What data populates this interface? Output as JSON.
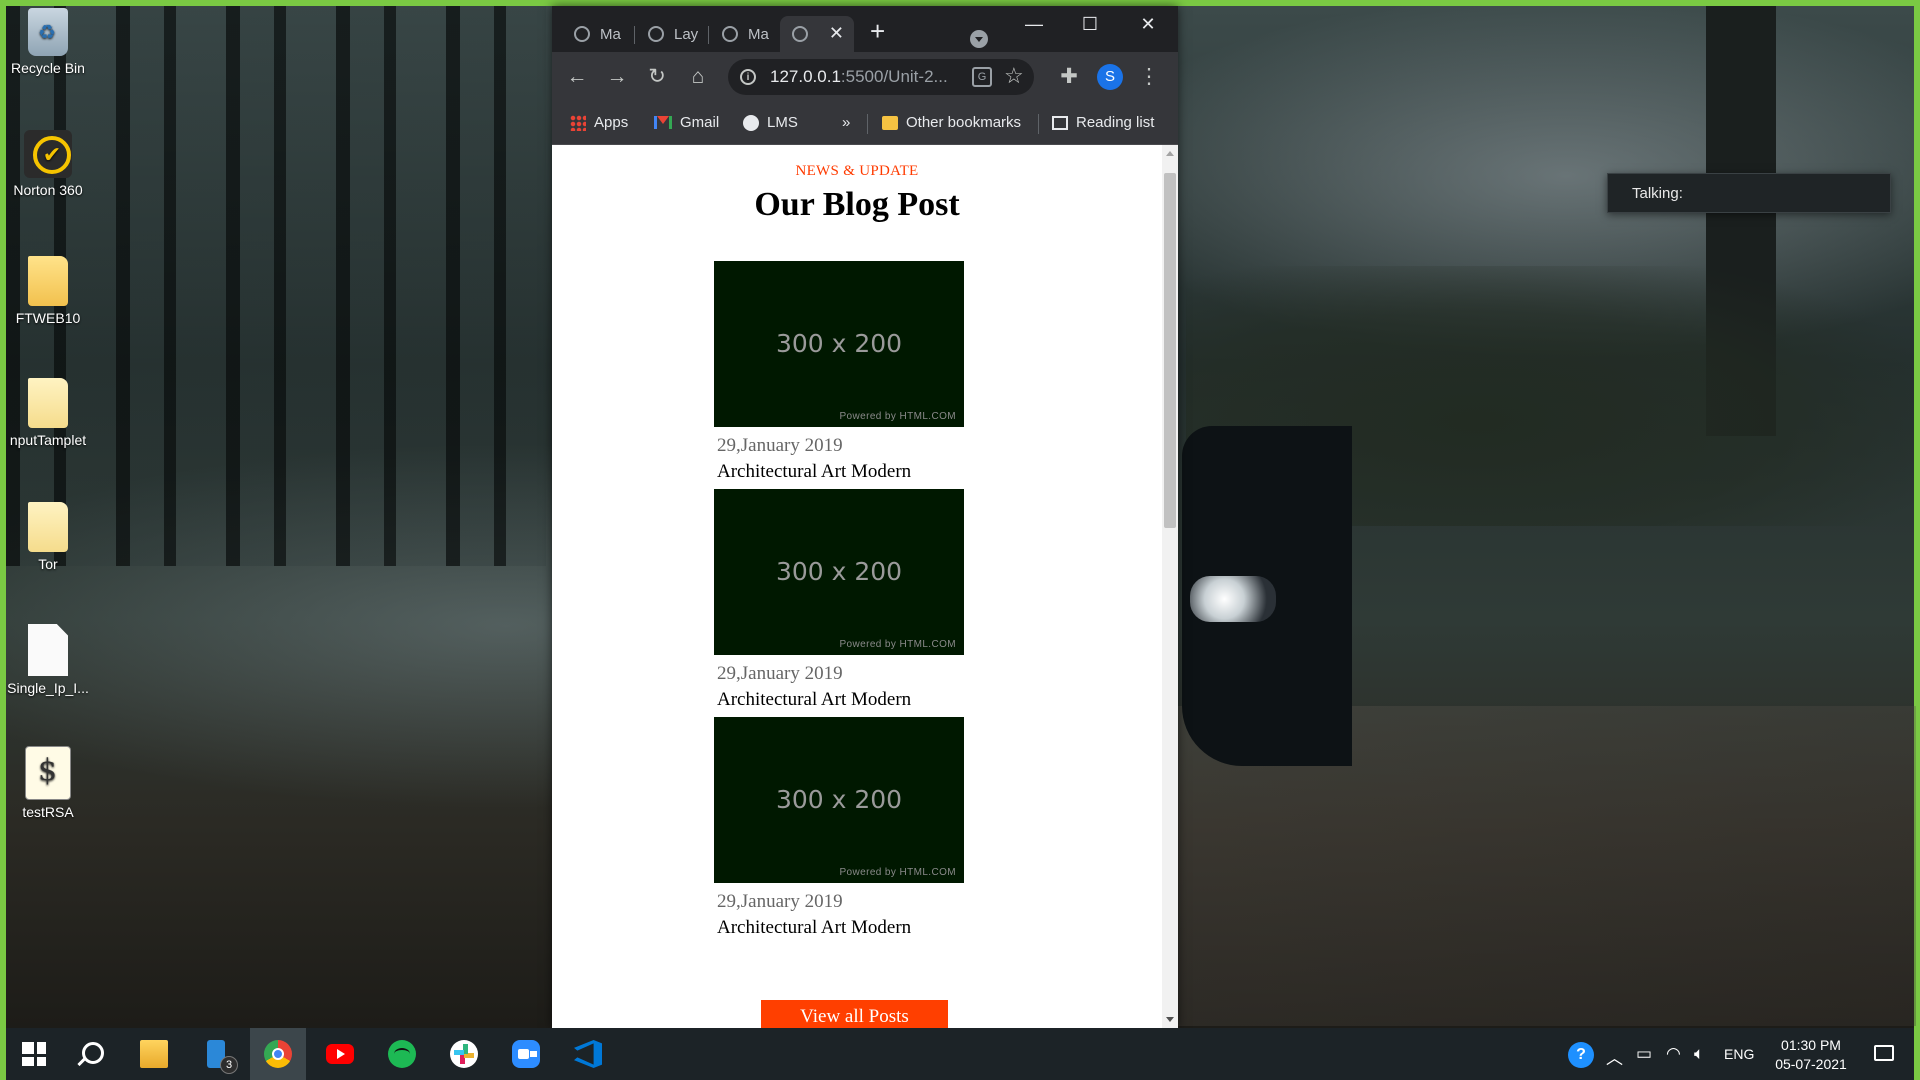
{
  "desktop": {
    "icons": [
      {
        "label": "Recycle Bin",
        "icon": "recycle-bin-icon"
      },
      {
        "label": "Norton 360",
        "icon": "norton-icon"
      },
      {
        "label": "FTWEB10",
        "icon": "folder-icon"
      },
      {
        "label": "nputTamplet",
        "icon": "folder-icon"
      },
      {
        "label": "Tor",
        "icon": "folder-icon"
      },
      {
        "label": "Single_Ip_I...",
        "icon": "document-icon"
      },
      {
        "label": "testRSA",
        "icon": "script-icon"
      }
    ],
    "talking_widget": {
      "label": "Talking:"
    }
  },
  "browser": {
    "tabs": [
      {
        "title": "Ma",
        "active": false
      },
      {
        "title": "Lay",
        "active": false
      },
      {
        "title": "Ma",
        "active": false
      },
      {
        "title": "",
        "active": true
      }
    ],
    "window_controls": {
      "minimize": "—",
      "maximize": "☐",
      "close": "✕"
    },
    "new_tab": "+",
    "address": {
      "host": "127.0.0.1",
      "rest": ":5500/Unit-2..."
    },
    "profile_initial": "S",
    "bookmarks": [
      {
        "label": "Apps",
        "icon": "apps-grid-icon"
      },
      {
        "label": "Gmail",
        "icon": "gmail-icon"
      },
      {
        "label": "LMS",
        "icon": "globe-icon"
      }
    ],
    "bookmarks_overflow": "»",
    "other_bookmarks": "Other bookmarks",
    "reading_list": "Reading list"
  },
  "page": {
    "kicker": "NEWS & UPDATE",
    "title": "Our Blog Post",
    "posts": [
      {
        "image_text": "300 x 200",
        "powered": "Powered by HTML.COM",
        "date": "29,January 2019",
        "title": "Architectural Art Modern"
      },
      {
        "image_text": "300 x 200",
        "powered": "Powered by HTML.COM",
        "date": "29,January 2019",
        "title": "Architectural Art Modern"
      },
      {
        "image_text": "300 x 200",
        "powered": "Powered by HTML.COM",
        "date": "29,January 2019",
        "title": "Architectural Art Modern"
      }
    ],
    "view_all_button": "View all Posts",
    "colors": {
      "accent": "#ff3f00",
      "thumb_bg": "#001800"
    }
  },
  "taskbar": {
    "apps": [
      "start-icon",
      "search-icon",
      "file-explorer-icon",
      "phone-link-icon",
      "chrome-icon",
      "youtube-icon",
      "spotify-icon",
      "slack-icon",
      "zoom-icon",
      "vscode-icon"
    ],
    "phone_badge": "3",
    "language": "ENG",
    "time": "01:30 PM",
    "date": "05-07-2021"
  }
}
